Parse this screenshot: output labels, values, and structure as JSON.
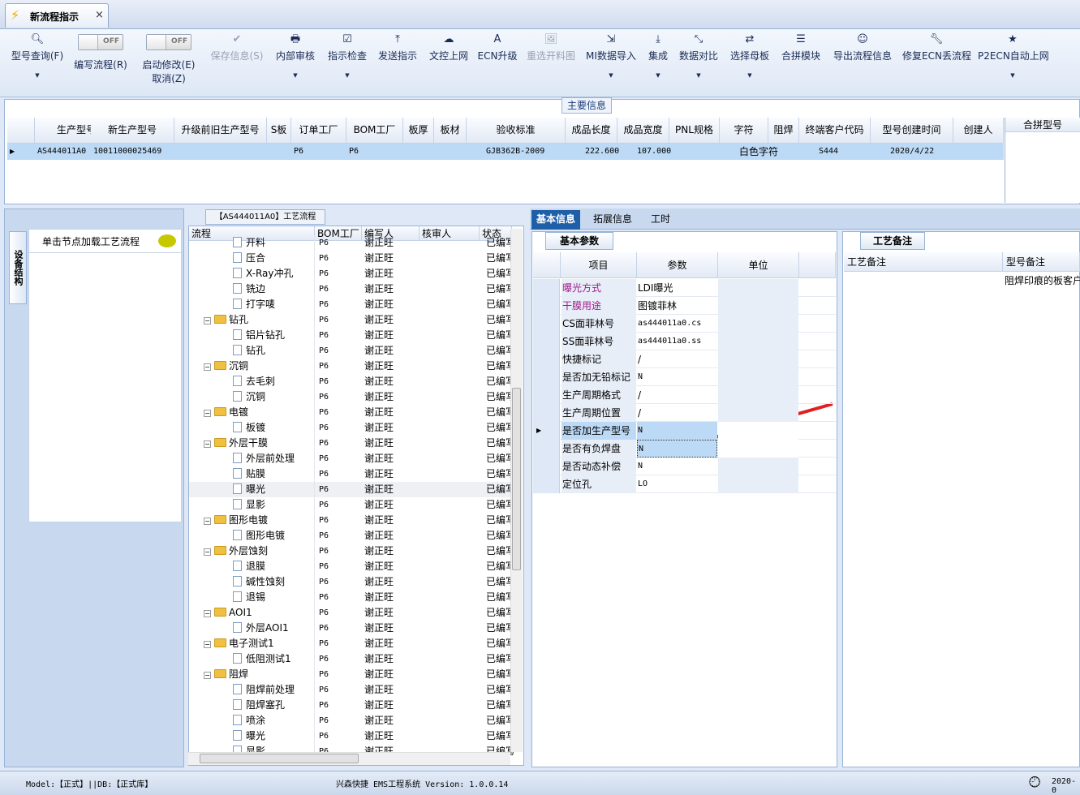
{
  "tab": {
    "title": "新流程指示",
    "close": "×"
  },
  "toolbar": {
    "query": "型号查询(F)",
    "edit_flow": "编写流程(R)",
    "edit_flow_state": "OFF",
    "start_modify": "启动修改(E)",
    "cancel": "取消(Z)",
    "start_modify_state": "OFF",
    "save": "保存信息(S)",
    "internal_review": "内部审核",
    "instr_check": "指示检查",
    "send_instr": "发送指示",
    "upload": "文控上网",
    "ecn_upgrade": "ECN升级",
    "reselect": "重选开料图",
    "mi_import": "MI数据导入",
    "integrate": "集成",
    "data_compare": "数据对比",
    "select_master": "选择母板",
    "merge_module": "合拼模块",
    "export_flow": "导出流程信息",
    "repair_ecn": "修复ECN丢流程",
    "p2ecn": "P2ECN自动上网"
  },
  "main_info": {
    "title": "主要信息",
    "columns": [
      "生产型号",
      "新生产型号",
      "升级前旧生产型号",
      "S板",
      "订单工厂",
      "BOM工厂",
      "板厚",
      "板材",
      "验收标准",
      "成品长度",
      "成品宽度",
      "PNL规格",
      "字符",
      "阻焊",
      "终端客户代码",
      "型号创建时间",
      "创建人"
    ],
    "row": [
      "AS444011A0",
      "10011000025469",
      "",
      "",
      "P6",
      "P6",
      "",
      "",
      "GJB362B-2009",
      "222.600",
      "107.000",
      "",
      "白色字符",
      "",
      "S444",
      "2020/4/22",
      ""
    ],
    "merge_title": "合拼型号"
  },
  "left": {
    "vtab": "设备结构",
    "hint": "单击节点加载工艺流程"
  },
  "tree": {
    "title": "【AS444011A0】工艺流程",
    "columns": [
      "流程",
      "BOM工厂",
      "编写人",
      "核审人",
      "状态"
    ],
    "rows": [
      {
        "t": "doc",
        "n": "开料",
        "bom": "P6",
        "w": "谢正旺",
        "s": "已编写"
      },
      {
        "t": "doc",
        "n": "压合",
        "bom": "P6",
        "w": "谢正旺",
        "s": "已编写"
      },
      {
        "t": "doc",
        "n": "X-Ray冲孔",
        "bom": "P6",
        "w": "谢正旺",
        "s": "已编写"
      },
      {
        "t": "doc",
        "n": "铣边",
        "bom": "P6",
        "w": "谢正旺",
        "s": "已编写"
      },
      {
        "t": "doc",
        "n": "打字唛",
        "bom": "P6",
        "w": "谢正旺",
        "s": "已编写"
      },
      {
        "t": "fold",
        "n": "钻孔",
        "bom": "P6",
        "w": "谢正旺",
        "s": "已编写"
      },
      {
        "t": "doc",
        "n": "铝片钻孔",
        "bom": "P6",
        "w": "谢正旺",
        "s": "已编写"
      },
      {
        "t": "doc",
        "n": "钻孔",
        "bom": "P6",
        "w": "谢正旺",
        "s": "已编写"
      },
      {
        "t": "fold",
        "n": "沉铜",
        "bom": "P6",
        "w": "谢正旺",
        "s": "已编写"
      },
      {
        "t": "doc",
        "n": "去毛刺",
        "bom": "P6",
        "w": "谢正旺",
        "s": "已编写"
      },
      {
        "t": "doc",
        "n": "沉铜",
        "bom": "P6",
        "w": "谢正旺",
        "s": "已编写"
      },
      {
        "t": "fold",
        "n": "电镀",
        "bom": "P6",
        "w": "谢正旺",
        "s": "已编写"
      },
      {
        "t": "doc",
        "n": "板镀",
        "bom": "P6",
        "w": "谢正旺",
        "s": "已编写"
      },
      {
        "t": "fold",
        "n": "外层干膜",
        "bom": "P6",
        "w": "谢正旺",
        "s": "已编写"
      },
      {
        "t": "doc",
        "n": "外层前处理",
        "bom": "P6",
        "w": "谢正旺",
        "s": "已编写"
      },
      {
        "t": "doc",
        "n": "贴膜",
        "bom": "P6",
        "w": "谢正旺",
        "s": "已编写"
      },
      {
        "t": "doc",
        "n": "曝光",
        "bom": "P6",
        "w": "谢正旺",
        "s": "已编写",
        "sel": true
      },
      {
        "t": "doc",
        "n": "显影",
        "bom": "P6",
        "w": "谢正旺",
        "s": "已编写"
      },
      {
        "t": "fold",
        "n": "图形电镀",
        "bom": "P6",
        "w": "谢正旺",
        "s": "已编写"
      },
      {
        "t": "doc",
        "n": "图形电镀",
        "bom": "P6",
        "w": "谢正旺",
        "s": "已编写"
      },
      {
        "t": "fold",
        "n": "外层蚀刻",
        "bom": "P6",
        "w": "谢正旺",
        "s": "已编写"
      },
      {
        "t": "doc",
        "n": "退膜",
        "bom": "P6",
        "w": "谢正旺",
        "s": "已编写"
      },
      {
        "t": "doc",
        "n": "碱性蚀刻",
        "bom": "P6",
        "w": "谢正旺",
        "s": "已编写"
      },
      {
        "t": "doc",
        "n": "退锡",
        "bom": "P6",
        "w": "谢正旺",
        "s": "已编写"
      },
      {
        "t": "fold",
        "n": "AOI1",
        "bom": "P6",
        "w": "谢正旺",
        "s": "已编写"
      },
      {
        "t": "doc",
        "n": "外层AOI1",
        "bom": "P6",
        "w": "谢正旺",
        "s": "已编写"
      },
      {
        "t": "fold",
        "n": "电子测试1",
        "bom": "P6",
        "w": "谢正旺",
        "s": "已编写"
      },
      {
        "t": "doc",
        "n": "低阻测试1",
        "bom": "P6",
        "w": "谢正旺",
        "s": "已编写"
      },
      {
        "t": "fold",
        "n": "阻焊",
        "bom": "P6",
        "w": "谢正旺",
        "s": "已编写"
      },
      {
        "t": "doc",
        "n": "阻焊前处理",
        "bom": "P6",
        "w": "谢正旺",
        "s": "已编写"
      },
      {
        "t": "doc",
        "n": "阻焊塞孔",
        "bom": "P6",
        "w": "谢正旺",
        "s": "已编写"
      },
      {
        "t": "doc",
        "n": "喷涂",
        "bom": "P6",
        "w": "谢正旺",
        "s": "已编写"
      },
      {
        "t": "doc",
        "n": "曝光",
        "bom": "P6",
        "w": "谢正旺",
        "s": "已编写"
      },
      {
        "t": "doc",
        "n": "显影",
        "bom": "P6",
        "w": "谢正旺",
        "s": "已编写"
      }
    ]
  },
  "right_tabs": [
    "基本信息",
    "拓展信息",
    "工时"
  ],
  "basic": {
    "title": "基本参数",
    "columns": [
      "项目",
      "参数",
      "单位"
    ],
    "rows": [
      {
        "item": "曝光方式",
        "val": "LDI曝光",
        "hl": true
      },
      {
        "item": "干膜用途",
        "val": "图镀菲林",
        "hl": true
      },
      {
        "item": "CS面菲林号",
        "val": "as444011a0.cs"
      },
      {
        "item": "SS面菲林号",
        "val": "as444011a0.ss"
      },
      {
        "item": "快捷标记",
        "val": "/"
      },
      {
        "item": "是否加无铅标记",
        "val": "N"
      },
      {
        "item": "生产周期格式",
        "val": "/"
      },
      {
        "item": "生产周期位置",
        "val": "/"
      },
      {
        "item": "是否加生产型号",
        "val": "N",
        "cur": true
      },
      {
        "item": "是否有负焊盘",
        "val": "N",
        "edit": true
      },
      {
        "item": "是否动态补偿",
        "val": "N"
      },
      {
        "item": "定位孔",
        "val": "LO"
      }
    ]
  },
  "remark": {
    "title": "工艺备注",
    "col1": "工艺备注",
    "col2": "型号备注",
    "note": "阻焊印痕的板客户"
  },
  "status": {
    "model": "Model:【正式】||DB:【正式库】",
    "app": "兴森快捷 EMS工程系统 Version: 1.0.0.14",
    "date": "2020-0"
  },
  "colors": {
    "accent": "#1f5fa8",
    "selected_row": "#bcd9f5",
    "highlight_text": "#a0198a",
    "arrow": "#e02020"
  }
}
